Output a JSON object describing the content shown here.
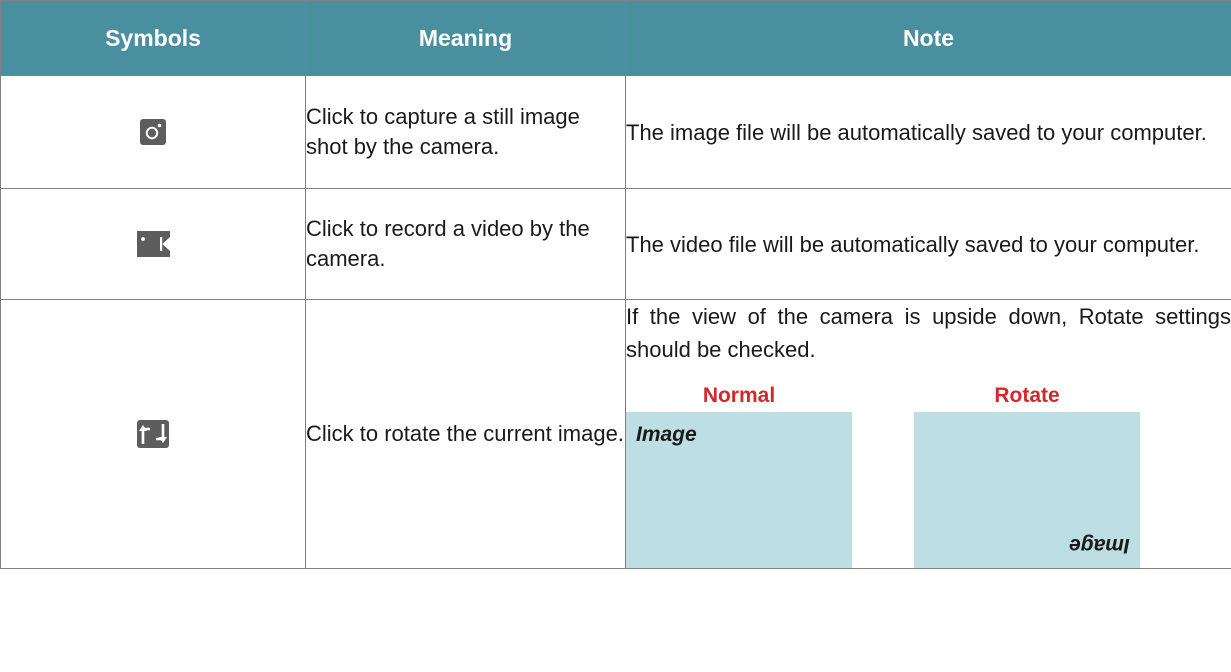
{
  "table": {
    "headers": [
      "Symbols",
      "Meaning",
      "Note"
    ],
    "rows": [
      {
        "icon": "camera-capture-icon",
        "meaning": "Click to capture a still image shot by the camera.",
        "note": "The image file will be automatically saved to your computer."
      },
      {
        "icon": "video-record-icon",
        "meaning": "Click to record a video by the camera.",
        "note": "The video file will be automatically saved to your computer."
      },
      {
        "icon": "rotate-icon",
        "meaning": "Click to rotate the current image.",
        "note": "If the view of the camera is upside down, Rotate settings should be checked.",
        "demo": {
          "normal_label": "Normal",
          "rotate_label": "Rotate",
          "image_word": "Image"
        }
      }
    ]
  },
  "colors": {
    "header_bg": "#4a8fa0",
    "header_text": "#ffffff",
    "icon_bg": "#5d5d5d",
    "demo_box": "#bddfe3",
    "demo_label": "#d4282a",
    "border": "#7f7f7f"
  }
}
